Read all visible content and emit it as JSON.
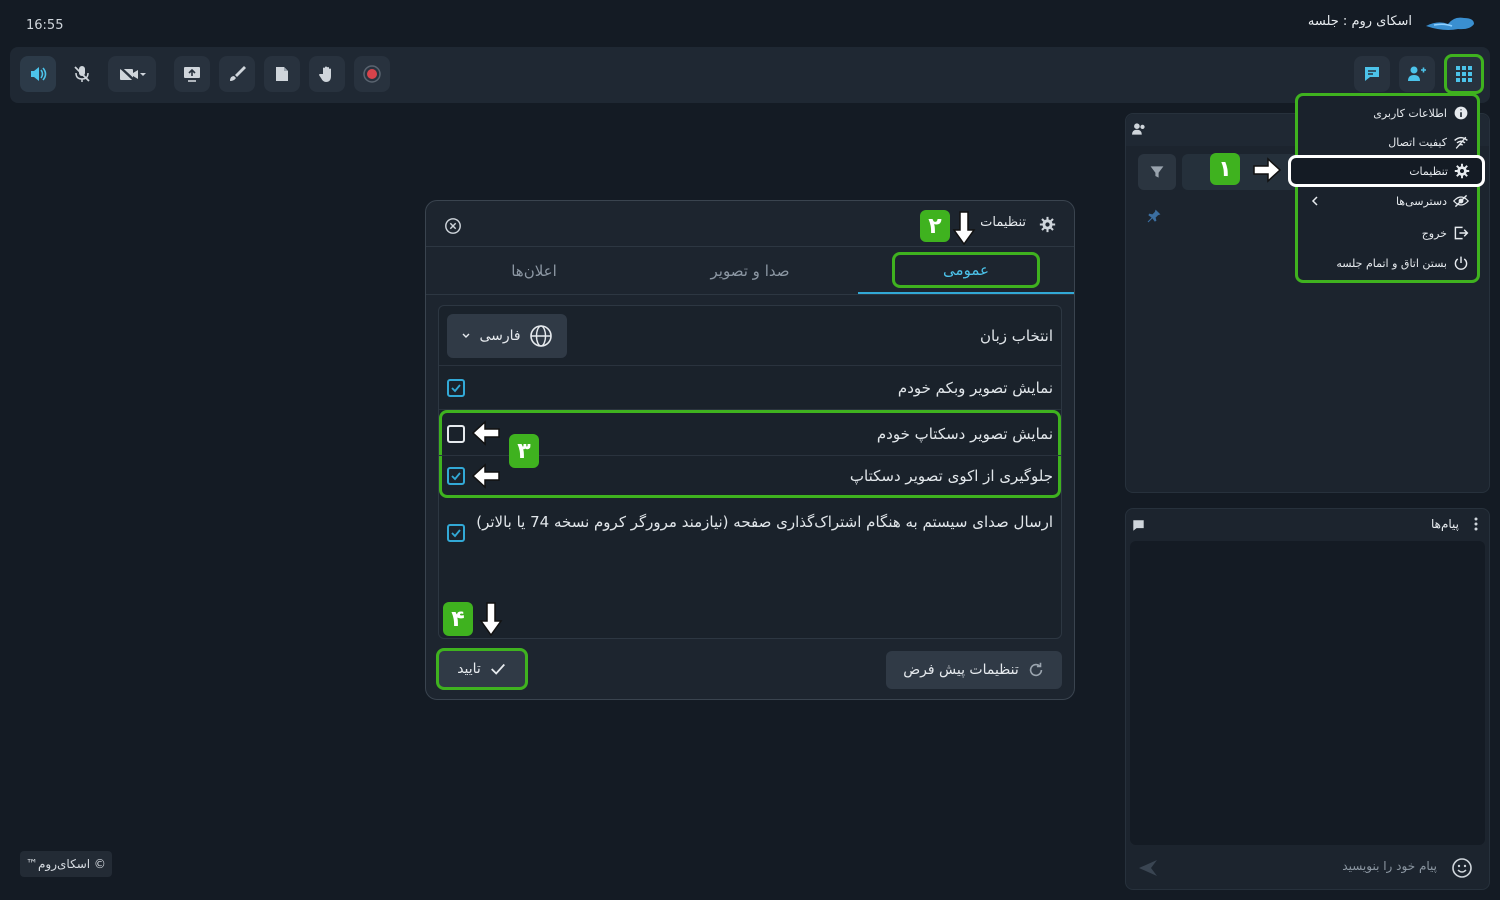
{
  "window": {
    "clock": "16:55",
    "title": "اسکای روم : جلسه"
  },
  "toolbar": {
    "left_buttons": [
      "speaker-icon",
      "mic-off-icon",
      "camera-off-icon",
      "share-screen-icon",
      "brush-icon",
      "file-icon",
      "raise-hand-icon",
      "record-icon"
    ],
    "right_buttons": [
      "chat-icon",
      "users-icon",
      "apps-grid-icon"
    ]
  },
  "menu": {
    "items": [
      {
        "label": "اطلاعات کاربری",
        "icon": "info-icon"
      },
      {
        "label": "کیفیت اتصال",
        "icon": "wifi-icon"
      },
      {
        "label": "تنظیمات",
        "icon": "gear-icon"
      },
      {
        "label": "دسترسی‌ها",
        "icon": "eye-off-icon"
      },
      {
        "label": "خروج",
        "icon": "exit-icon"
      },
      {
        "label": "بستن اتاق و اتمام جلسه",
        "icon": "power-icon"
      }
    ]
  },
  "dialog": {
    "title": "تنظیمات",
    "tabs": [
      "عمومی",
      "صدا و تصویر",
      "اعلان‌ها"
    ],
    "active_tab": "عمومی",
    "language": {
      "label": "انتخاب زبان",
      "value": "فارسی"
    },
    "options": [
      {
        "label": "نمایش تصویر وبکم خودم",
        "checked": true
      },
      {
        "label": "نمایش تصویر دسکتاپ خودم",
        "checked": false
      },
      {
        "label": "جلوگیری از اکوی تصویر دسکتاپ",
        "checked": true
      },
      {
        "label": "ارسال صدای سیستم به هنگام اشتراک‌گذاری صفحه (نیازمند مرورگر کروم نسخه 74 یا بالاتر)",
        "checked": true
      }
    ],
    "default_button": "تنظیمات پیش فرض",
    "ok_button": "تایید"
  },
  "annotations": {
    "badges": [
      "۱",
      "۲",
      "۳",
      "۴"
    ],
    "highlight_color": "#3fb21f"
  },
  "messages": {
    "title": "پیام‌ها",
    "placeholder": "پیام خود را بنویسید"
  },
  "footer": {
    "copyright": "© اسکای‌روم™"
  },
  "colors": {
    "accent": "#32a9d6",
    "background": "#141b24",
    "panel": "#1d252f"
  }
}
